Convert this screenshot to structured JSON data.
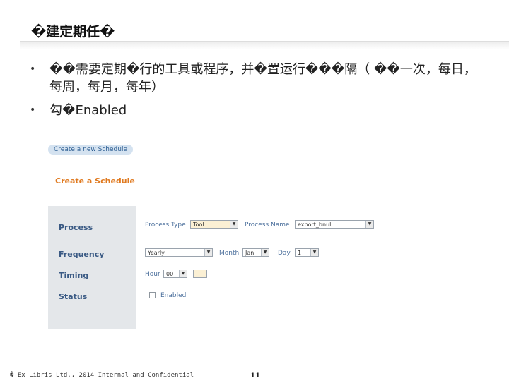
{
  "slide": {
    "title": "�建定期任�",
    "bullets": [
      "��需要定期�行的工具或程序，并�置运行���隔（ ��一次，每日，每周，每月，每年）",
      "勾�Enabled"
    ]
  },
  "screenshot": {
    "tab_label": "Create a new Schedule",
    "heading": "Create a Schedule",
    "rows": {
      "process": "Process",
      "frequency": "Frequency",
      "timing": "Timing",
      "status": "Status"
    },
    "fields": {
      "process_type_label": "Process Type",
      "process_type_value": "Tool",
      "process_name_label": "Process Name",
      "process_name_value": "export_bnull",
      "frequency_value": "Yearly",
      "month_label": "Month",
      "month_value": "Jan",
      "day_label": "Day",
      "day_value": "1",
      "hour_label": "Hour",
      "hour_value": "00",
      "enabled_label": "Enabled",
      "enabled_checked": false
    }
  },
  "footer": {
    "text": "� Ex Libris Ltd., 2014 Internal and Confidential",
    "page_number": "11"
  },
  "colors": {
    "accent_orange": "#e07a20",
    "label_blue": "#3a5a84",
    "tab_blue": "#d4e2f0"
  },
  "icons": {
    "dropdown": "chevron-down-icon",
    "checkbox": "checkbox-icon"
  }
}
